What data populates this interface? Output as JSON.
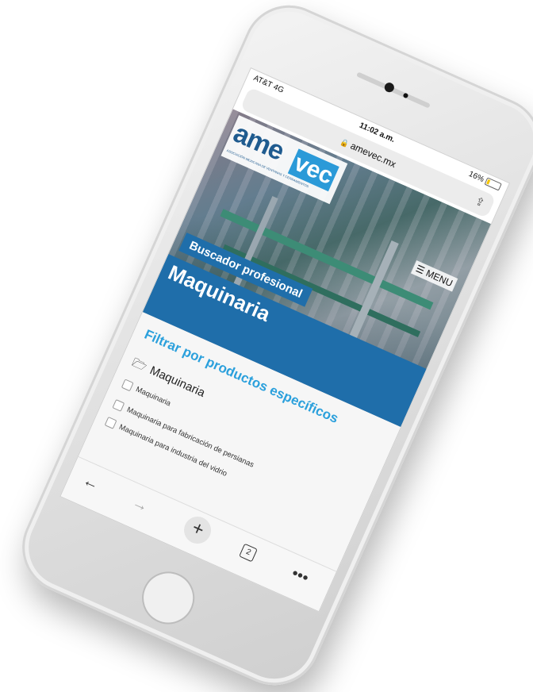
{
  "status": {
    "carrier": "AT&T 4G",
    "time": "11:02 a.m.",
    "battery": "16%"
  },
  "browser": {
    "url": "amevec.mx",
    "share_icon": "share-icon"
  },
  "site": {
    "logo": {
      "ame": "ame",
      "vec": "vec",
      "tagline": "ASOCIACIÓN MEXICANA DE VENTANAS Y CERRAMIENTOS"
    },
    "menu_label": "MENU",
    "subtitle": "Buscador profesional",
    "title": "Maquinaria",
    "filter_title": "Filtrar por productos específicos",
    "category": "Maquinaria",
    "options": [
      "Maquinaria",
      "Maquinaria para fabricación de persianas",
      "Maquinaria para industria del vidrio"
    ]
  },
  "toolbar": {
    "back": "←",
    "forward": "→",
    "new_tab": "+",
    "tab_count": "2",
    "more": "•••"
  },
  "colors": {
    "brand_blue": "#1f6eaa",
    "accent_cyan": "#2ba0dc"
  }
}
